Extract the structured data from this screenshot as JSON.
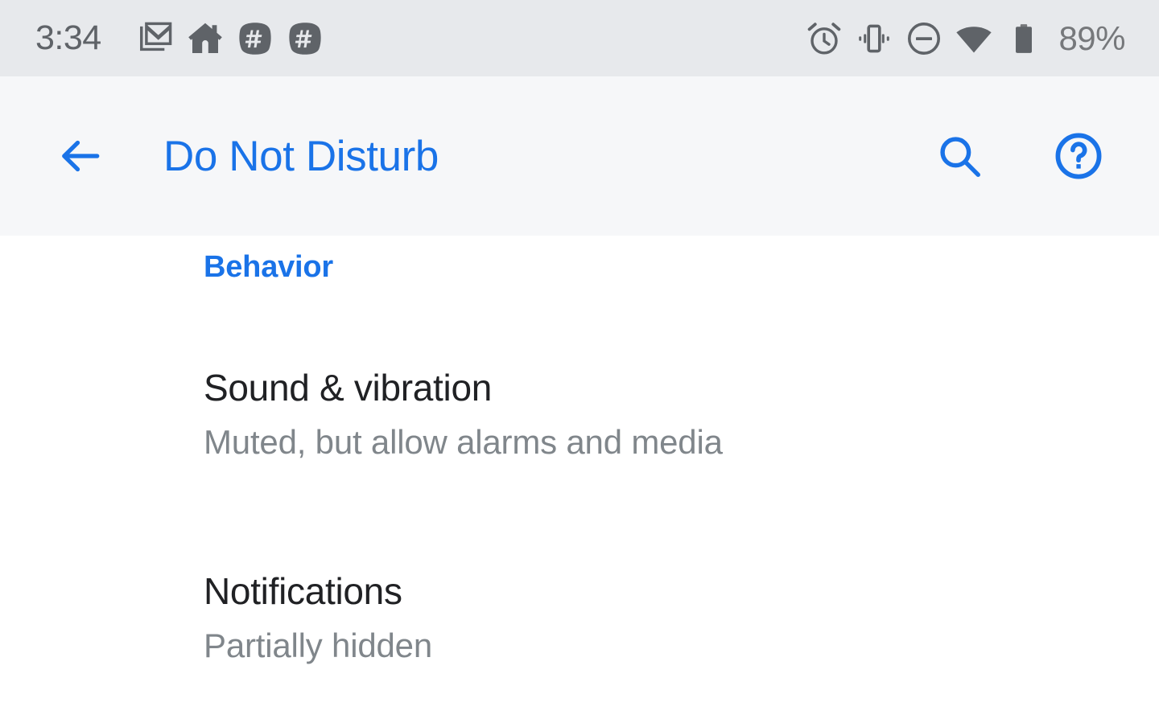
{
  "status_bar": {
    "time": "3:34",
    "battery_percent": "89%",
    "left_icons": [
      {
        "name": "gmail-icon",
        "label": "Gmail"
      },
      {
        "name": "home-icon",
        "label": "Home"
      },
      {
        "name": "slack-channel-icon-1",
        "label": "Slack"
      },
      {
        "name": "slack-channel-icon-2",
        "label": "Slack"
      }
    ],
    "right_icons": [
      {
        "name": "alarm-icon",
        "label": "Alarm set"
      },
      {
        "name": "vibrate-icon",
        "label": "Vibrate"
      },
      {
        "name": "do-not-disturb-icon",
        "label": "Do Not Disturb on"
      },
      {
        "name": "wifi-icon",
        "label": "Wi-Fi"
      },
      {
        "name": "battery-icon",
        "label": "Battery"
      }
    ],
    "background_color": "#e7e9ec",
    "foreground_color": "#5f6368"
  },
  "app_bar": {
    "title": "Do Not Disturb",
    "back_label": "Navigate up",
    "search_label": "Search",
    "help_label": "Help & feedback",
    "accent_color": "#1a73e8",
    "background_color": "#f6f7f9"
  },
  "content": {
    "section_header": "Behavior",
    "items": [
      {
        "title": "Sound & vibration",
        "summary": "Muted, but allow alarms and media"
      },
      {
        "title": "Notifications",
        "summary": "Partially hidden"
      }
    ],
    "title_color": "#202124",
    "summary_color": "#80868b"
  }
}
